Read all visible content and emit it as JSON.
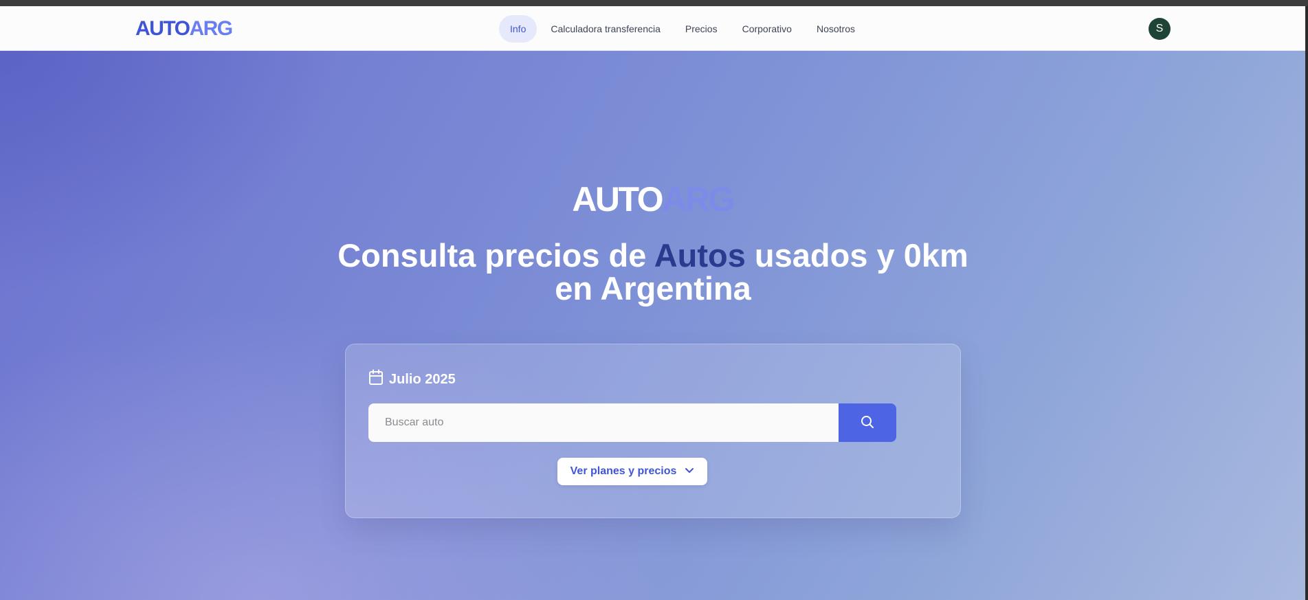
{
  "header": {
    "brand": {
      "part1": "AUTO",
      "part2": "ARG"
    },
    "nav": [
      {
        "label": "Info",
        "active": true
      },
      {
        "label": "Calculadora transferencia",
        "active": false
      },
      {
        "label": "Precios",
        "active": false
      },
      {
        "label": "Corporativo",
        "active": false
      },
      {
        "label": "Nosotros",
        "active": false
      }
    ],
    "avatar_initial": "S"
  },
  "hero": {
    "logo": {
      "part1": "AUTO",
      "part2": "ARG"
    },
    "headline": {
      "before": "Consulta precios de ",
      "highlight": "Autos",
      "after": " usados y 0km en Argentina"
    },
    "date_label": "Julio 2025",
    "search": {
      "placeholder": "Buscar auto",
      "value": ""
    },
    "plans_button": "Ver planes y precios"
  },
  "icons": {
    "calendar": "calendar-icon",
    "search": "search-icon",
    "chevron": "chevron-down-icon"
  },
  "colors": {
    "brand_primary": "#3f55d6",
    "brand_secondary": "#6b7ef0",
    "search_button": "#4d64e4",
    "headline_highlight": "#2b3a8f",
    "avatar_bg": "#1f4436"
  }
}
